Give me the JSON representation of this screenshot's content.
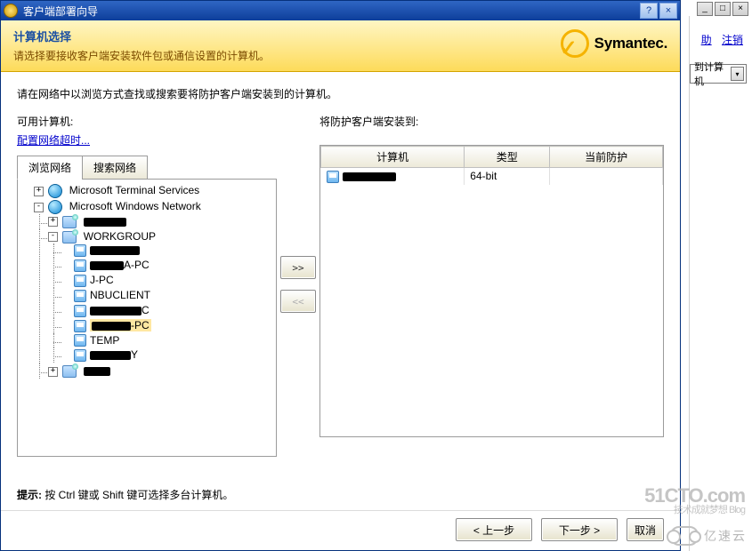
{
  "bg": {
    "help": "助",
    "logout": "注销",
    "combo": "到计算机"
  },
  "dialog": {
    "title": "客户端部署向导",
    "banner_title": "计算机选择",
    "banner_sub": "请选择要接收客户端安装软件包或通信设置的计算机。",
    "brand": "Symantec.",
    "instruction": "请在网络中以浏览方式查找或搜索要将防护客户端安装到的计算机。",
    "left_label": "可用计算机:",
    "config_link": "配置网络超时...",
    "tabs": {
      "browse": "浏览网络",
      "search": "搜索网络"
    },
    "tree": {
      "root1": "Microsoft Terminal Services",
      "root2": "Microsoft Windows Network",
      "workgroup": "WORKGROUP",
      "n_jpc": "J-PC",
      "n_nbu": "NBUCLIENT",
      "n_pc_suffix": "-PC",
      "n_temp": "TEMP",
      "n_apc": "A-PC"
    },
    "move": {
      "add": ">>",
      "remove": "<<"
    },
    "right_label": "将防护客户端安装到:",
    "grid": {
      "h_computer": "计算机",
      "h_type": "类型",
      "h_prot": "当前防护",
      "row1_type": "64-bit"
    },
    "hint_label": "提示:",
    "hint_text": " 按 Ctrl 键或 Shift 键可选择多台计算机。",
    "buttons": {
      "back": "< 上一步",
      "next": "下一步 >",
      "cancel": "取消"
    }
  },
  "watermark": {
    "site": "51CTO.com",
    "sub": "技术成就梦想   Blog",
    "cloud": "亿速云"
  }
}
